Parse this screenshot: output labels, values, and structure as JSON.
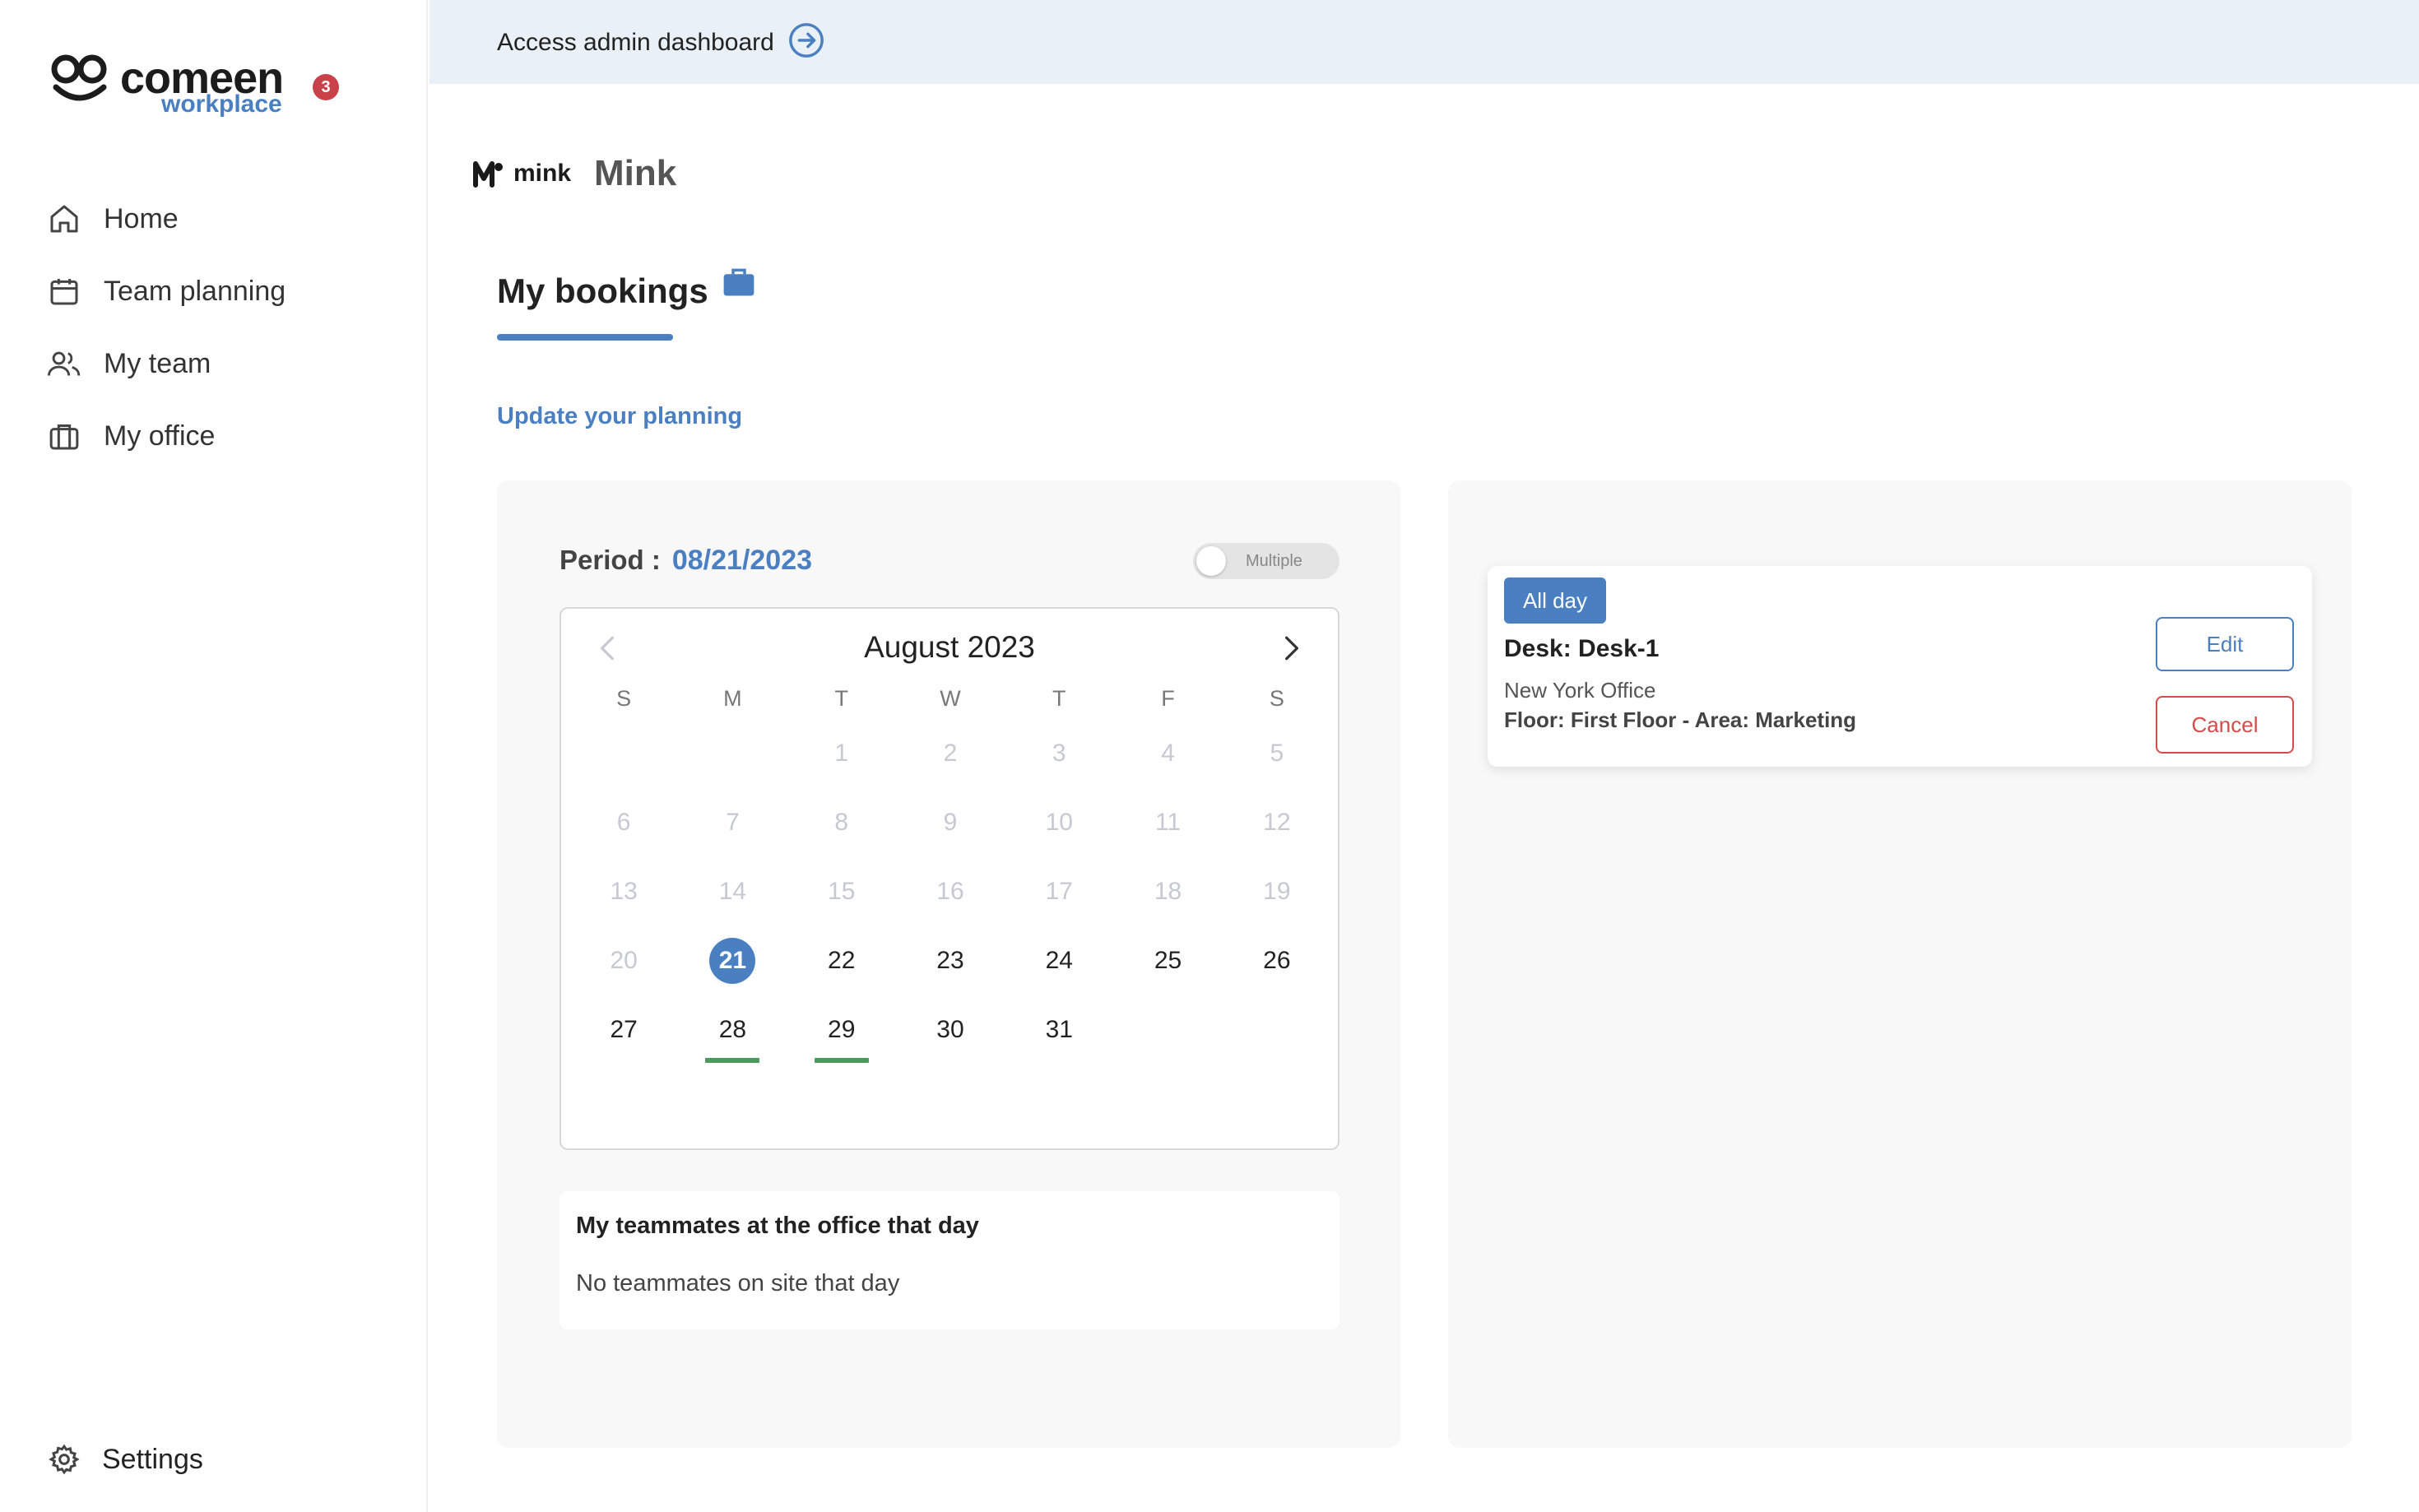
{
  "brand": {
    "name": "comeen",
    "sub": "workplace",
    "notification_count": "3"
  },
  "sidebar": {
    "items": [
      {
        "label": "Home",
        "icon": "home-icon"
      },
      {
        "label": "Team planning",
        "icon": "calendar-icon"
      },
      {
        "label": "My team",
        "icon": "users-icon"
      },
      {
        "label": "My office",
        "icon": "briefcase-icon"
      }
    ],
    "settings_label": "Settings"
  },
  "admin_bar": {
    "label": "Access admin dashboard"
  },
  "company": {
    "logo_text": "mink",
    "name": "Mink"
  },
  "tab": {
    "label": "My bookings"
  },
  "update_link": "Update your planning",
  "period": {
    "label": "Period :",
    "value": "08/21/2023"
  },
  "toggle": {
    "label": "Multiple",
    "on": false
  },
  "calendar": {
    "month_label": "August 2023",
    "weekdays": [
      "S",
      "M",
      "T",
      "W",
      "T",
      "F",
      "S"
    ],
    "selected_day": 21,
    "marked_days": [
      28,
      29
    ],
    "weeks": [
      [
        "",
        "",
        "1",
        "2",
        "3",
        "4",
        "5"
      ],
      [
        "6",
        "7",
        "8",
        "9",
        "10",
        "11",
        "12"
      ],
      [
        "13",
        "14",
        "15",
        "16",
        "17",
        "18",
        "19"
      ],
      [
        "20",
        "21",
        "22",
        "23",
        "24",
        "25",
        "26"
      ],
      [
        "27",
        "28",
        "29",
        "30",
        "31",
        "",
        ""
      ]
    ],
    "first_active_day": 21
  },
  "teammates": {
    "title": "My teammates at the office that day",
    "empty_text": "No teammates on site that day"
  },
  "booking": {
    "badge": "All day",
    "desk": "Desk: Desk-1",
    "office": "New York Office",
    "floor": "Floor: First Floor - Area: Marketing",
    "edit_label": "Edit",
    "cancel_label": "Cancel"
  },
  "colors": {
    "accent": "#4a7fc1",
    "danger": "#d64a4a",
    "marker": "#4a9a5c",
    "badge": "#c9424a"
  }
}
